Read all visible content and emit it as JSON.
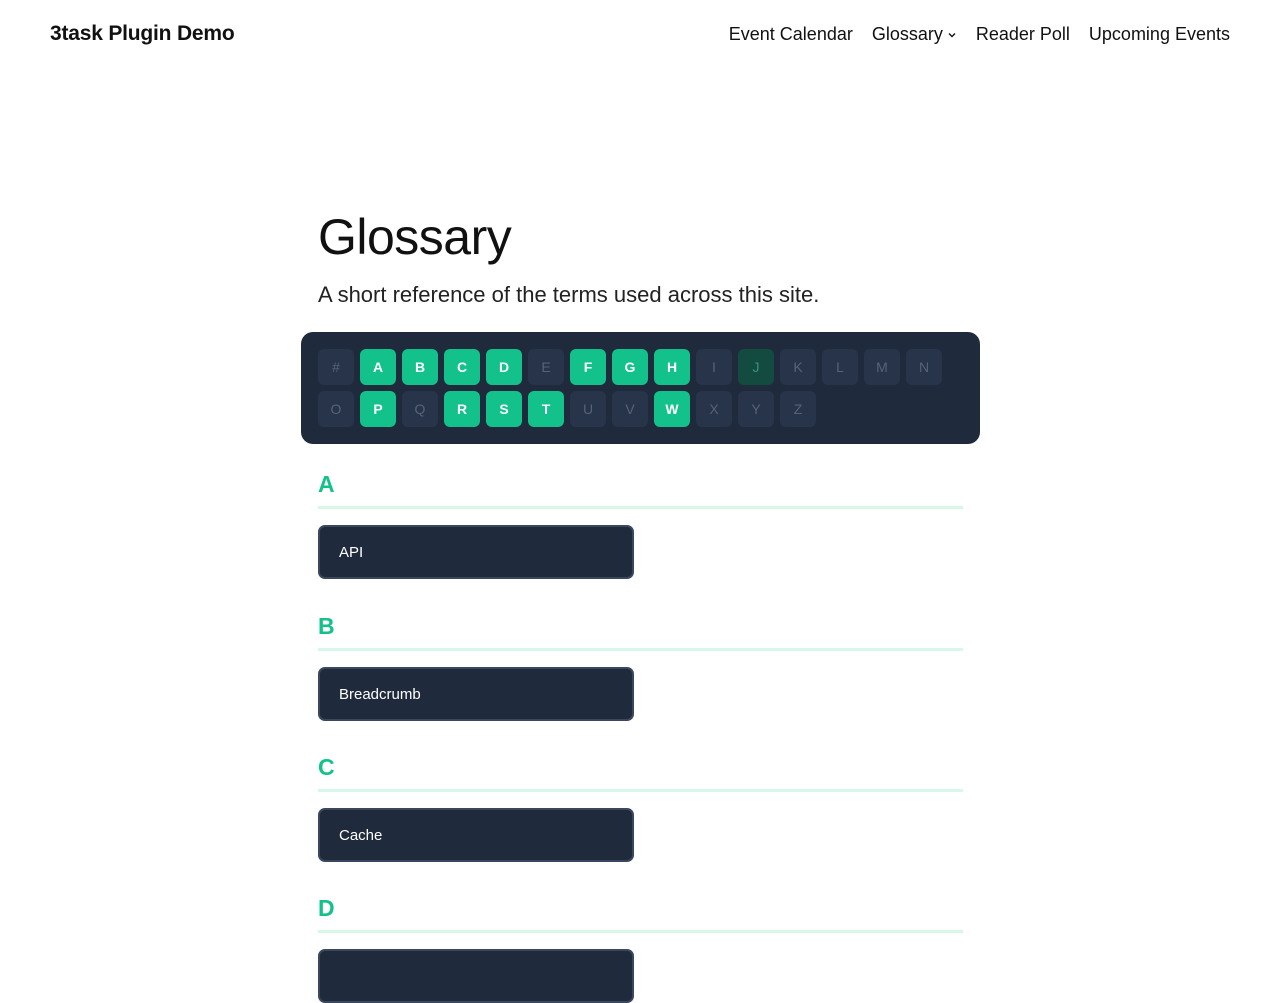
{
  "header": {
    "site_title": "3task Plugin Demo",
    "nav": [
      {
        "label": "Event Calendar"
      },
      {
        "label": "Glossary",
        "has_dropdown": true
      },
      {
        "label": "Reader Poll"
      },
      {
        "label": "Upcoming Events"
      }
    ]
  },
  "page": {
    "title": "Glossary",
    "subtitle": "A short reference of the terms used across this site."
  },
  "letter_nav": {
    "letters": [
      {
        "char": "#",
        "state": "disabled"
      },
      {
        "char": "A",
        "state": "active"
      },
      {
        "char": "B",
        "state": "active"
      },
      {
        "char": "C",
        "state": "active"
      },
      {
        "char": "D",
        "state": "active"
      },
      {
        "char": "E",
        "state": "disabled"
      },
      {
        "char": "F",
        "state": "active"
      },
      {
        "char": "G",
        "state": "active"
      },
      {
        "char": "H",
        "state": "active"
      },
      {
        "char": "I",
        "state": "disabled"
      },
      {
        "char": "J",
        "state": "current"
      },
      {
        "char": "K",
        "state": "disabled"
      },
      {
        "char": "L",
        "state": "disabled"
      },
      {
        "char": "M",
        "state": "disabled"
      },
      {
        "char": "N",
        "state": "disabled"
      },
      {
        "char": "O",
        "state": "disabled"
      },
      {
        "char": "P",
        "state": "active"
      },
      {
        "char": "Q",
        "state": "disabled"
      },
      {
        "char": "R",
        "state": "active"
      },
      {
        "char": "S",
        "state": "active"
      },
      {
        "char": "T",
        "state": "active"
      },
      {
        "char": "U",
        "state": "disabled"
      },
      {
        "char": "V",
        "state": "disabled"
      },
      {
        "char": "W",
        "state": "active"
      },
      {
        "char": "X",
        "state": "disabled"
      },
      {
        "char": "Y",
        "state": "disabled"
      },
      {
        "char": "Z",
        "state": "disabled"
      }
    ]
  },
  "sections": [
    {
      "letter": "A",
      "terms": [
        "API"
      ]
    },
    {
      "letter": "B",
      "terms": [
        "Breadcrumb"
      ]
    },
    {
      "letter": "C",
      "terms": [
        "Cache"
      ]
    },
    {
      "letter": "D",
      "terms": [
        ""
      ]
    }
  ],
  "colors": {
    "accent": "#12c28a",
    "dark_panel": "#1f2a3c",
    "rule": "#d6f7ea"
  }
}
